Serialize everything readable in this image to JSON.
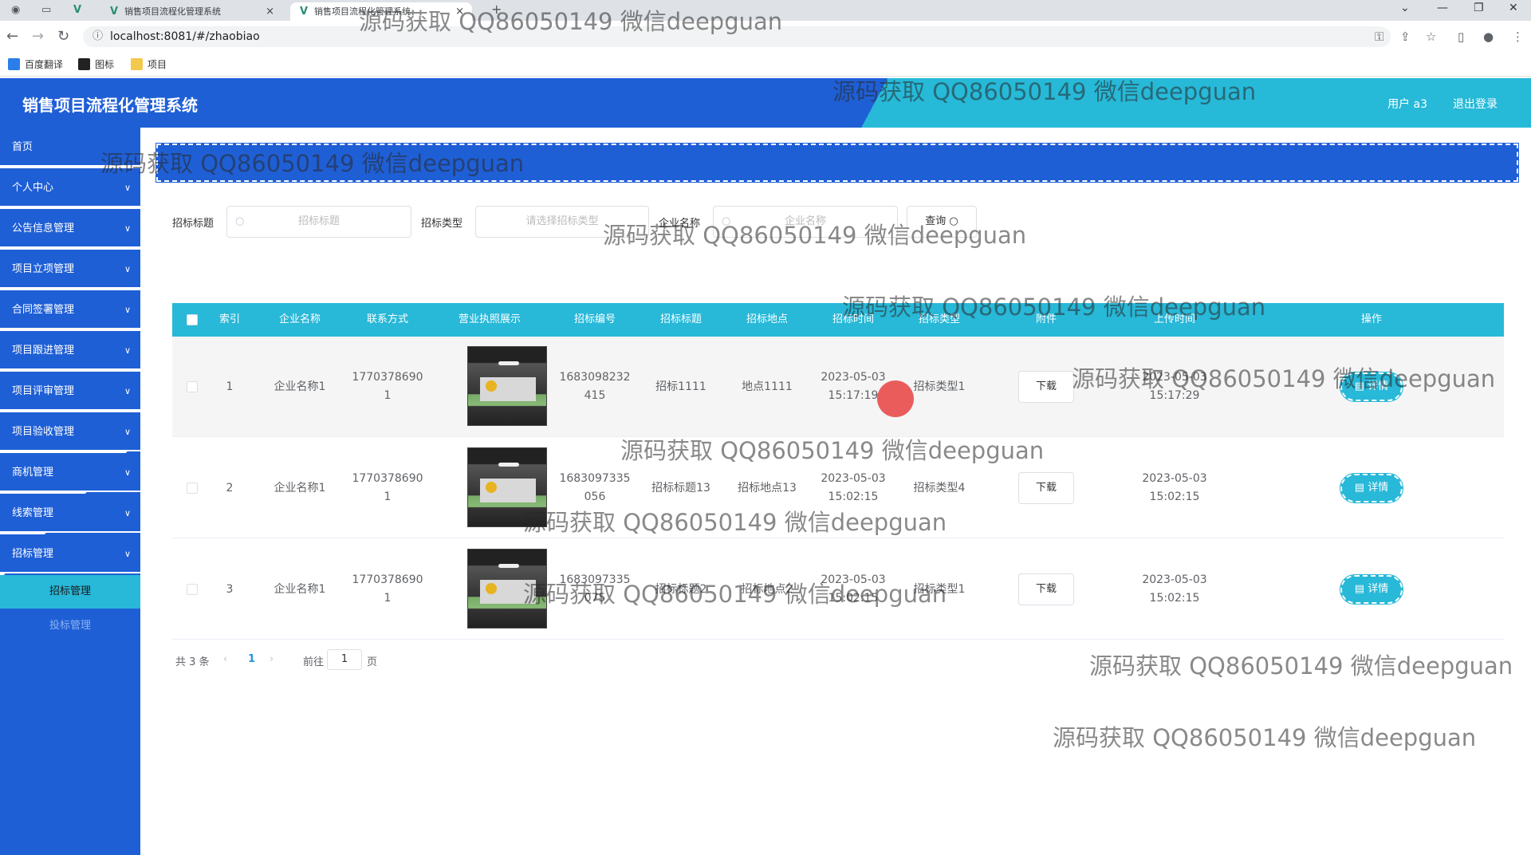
{
  "browser": {
    "tabs": [
      {
        "title": "销售项目流程化管理系统",
        "close": "×"
      },
      {
        "title": "销售项目流程化管理系统",
        "close": "×"
      }
    ],
    "new_tab": "+",
    "url": "localhost:8081/#/zhaobiao",
    "bookmarks": [
      "百度翻译",
      "图标",
      "项目"
    ]
  },
  "header": {
    "title": "销售项目流程化管理系统",
    "user": "用户 a3",
    "logout": "退出登录"
  },
  "sidebar": {
    "items": [
      {
        "label": "首页"
      },
      {
        "label": "个人中心"
      },
      {
        "label": "公告信息管理"
      },
      {
        "label": "项目立项管理"
      },
      {
        "label": "合同签署管理"
      },
      {
        "label": "项目跟进管理"
      },
      {
        "label": "项目评审管理"
      },
      {
        "label": "项目验收管理"
      },
      {
        "label": "商机管理"
      },
      {
        "label": "线索管理"
      },
      {
        "label": "招标管理"
      }
    ],
    "subitems": [
      {
        "label": "招标管理",
        "active": true
      },
      {
        "label": "投标管理",
        "active": false
      }
    ]
  },
  "search": {
    "title_label": "招标标题",
    "title_placeholder": "招标标题",
    "type_label": "招标类型",
    "type_placeholder": "请选择招标类型",
    "company_label": "企业名称",
    "company_placeholder": "企业名称",
    "query_button": "查询"
  },
  "table": {
    "columns": [
      "索引",
      "企业名称",
      "联系方式",
      "营业执照展示",
      "招标编号",
      "招标标题",
      "招标地点",
      "招标时间",
      "招标类型",
      "附件",
      "上传时间",
      "操作"
    ],
    "rows": [
      {
        "index": "1",
        "company": "企业名称1",
        "phone": [
          "1770378690",
          "1"
        ],
        "number": [
          "1683098232",
          "415"
        ],
        "title": "招标1111",
        "place": "地点1111",
        "time": [
          "2023-05-03",
          "15:17:19"
        ],
        "type": "招标类型1",
        "download": "下载",
        "upload": [
          "2023-05-03",
          "15:17:29"
        ],
        "action": "详情"
      },
      {
        "index": "2",
        "company": "企业名称1",
        "phone": [
          "1770378690",
          "1"
        ],
        "number": [
          "1683097335",
          "056"
        ],
        "title": "招标标题13",
        "place": "招标地点13",
        "time": [
          "2023-05-03",
          "15:02:15"
        ],
        "type": "招标类型4",
        "download": "下载",
        "upload": [
          "2023-05-03",
          "15:02:15"
        ],
        "action": "详情"
      },
      {
        "index": "3",
        "company": "企业名称1",
        "phone": [
          "1770378690",
          "1"
        ],
        "number": [
          "1683097335",
          "075"
        ],
        "title": "招标标题2",
        "place": "招标地点2",
        "time": [
          "2023-05-03",
          "15:02:15"
        ],
        "type": "招标类型1",
        "download": "下载",
        "upload": [
          "2023-05-03",
          "15:02:15"
        ],
        "action": "详情"
      }
    ]
  },
  "pagination": {
    "total": "共 3 条",
    "current": "1",
    "goto": "前往",
    "page_input": "1",
    "page_suffix": "页"
  },
  "watermark": "源码获取 QQ86050149 微信deepguan",
  "colors": {
    "primary": "#1f5fd6",
    "accent": "#28b8d8"
  }
}
